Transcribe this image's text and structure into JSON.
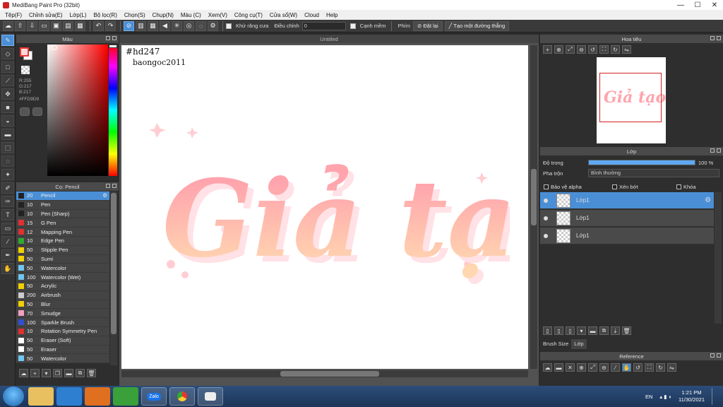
{
  "window": {
    "title": "MediBang Paint Pro (32bit)",
    "controls": [
      "—",
      "☐",
      "✕"
    ]
  },
  "menu": [
    "Tệp(F)",
    "Chỉnh sửa(E)",
    "Lớp(L)",
    "Bộ lọc(R)",
    "Chọn(S)",
    "Chụp(N)",
    "Màu (C)",
    "Xem(V)",
    "Công cụ(T)",
    "Cửa sổ(W)",
    "Cloud",
    "Help"
  ],
  "toolbar": {
    "antialias_label": "Khử răng cưa",
    "correction_label": "Điều chỉnh",
    "correction_value": "0",
    "edge_label": "Cạnh mềm",
    "key_label": "Phím",
    "reset_label": "Đặt lại",
    "straight_line_label": "Tạo một đường thẳng"
  },
  "color_panel": {
    "title": "Màu",
    "r": "R:255",
    "g": "G:217",
    "b": "B:217",
    "hex": "#FFD9D9",
    "primary": "#FFD9D9"
  },
  "brush_panel": {
    "title": "Cọ: Pencil",
    "brushes": [
      {
        "size": "20",
        "name": "Pencil",
        "color": "#222222"
      },
      {
        "size": "10",
        "name": "Pen",
        "color": "#222222"
      },
      {
        "size": "10",
        "name": "Pen (Sharp)",
        "color": "#222222"
      },
      {
        "size": "15",
        "name": "G Pen",
        "color": "#e03030"
      },
      {
        "size": "12",
        "name": "Mapping Pen",
        "color": "#e03030"
      },
      {
        "size": "10",
        "name": "Edge Pen",
        "color": "#2faa2f"
      },
      {
        "size": "50",
        "name": "Stipple Pen",
        "color": "#f0d000"
      },
      {
        "size": "50",
        "name": "Sumi",
        "color": "#f0d000"
      },
      {
        "size": "50",
        "name": "Watercolor",
        "color": "#6fc6f0"
      },
      {
        "size": "100",
        "name": "Watercolor (Wet)",
        "color": "#6fc6f0"
      },
      {
        "size": "50",
        "name": "Acrylic",
        "color": "#f0d000"
      },
      {
        "size": "200",
        "name": "Airbrush",
        "color": "#cccccc"
      },
      {
        "size": "50",
        "name": "Blur",
        "color": "#f0d000"
      },
      {
        "size": "70",
        "name": "Smudge",
        "color": "#f3a0c0"
      },
      {
        "size": "100",
        "name": "Sparkle Brush",
        "color": "#3050d0"
      },
      {
        "size": "10",
        "name": "Rotation Symmetry Pen",
        "color": "#e03030"
      },
      {
        "size": "50",
        "name": "Eraser (Soft)",
        "color": "#ffffff"
      },
      {
        "size": "50",
        "name": "Eraser",
        "color": "#ffffff"
      },
      {
        "size": "50",
        "name": "Watercolor",
        "color": "#6fc6f0"
      }
    ]
  },
  "canvas": {
    "tab": "Untitled",
    "hashtag": "#hd247",
    "author": "baongoc2011",
    "art_text": "Giả tạo",
    "art_top": "#ffa4ad",
    "art_bottom": "#ffd7b0",
    "art_shadow": "#ffe1e6"
  },
  "navigator": {
    "title": "Hoa tiêu",
    "frame_color": "#d22222"
  },
  "layer_panel": {
    "title": "Lớp",
    "opacity_label": "Độ trong",
    "opacity_value": "100 %",
    "blend_label": "Pha trộn",
    "blend_value": "Bình thường",
    "protect_alpha": "Bảo vệ alpha",
    "clipping": "Xén bớt",
    "lock": "Khóa",
    "layers": [
      "Lớp1",
      "Lớp1",
      "Lớp1"
    ],
    "tab_brush_size": "Brush Size",
    "tab_layer": "Lớp"
  },
  "reference_panel": {
    "title": "Reference"
  },
  "taskbar": {
    "apps": [
      "",
      "",
      "",
      "",
      "Zalo",
      "",
      ""
    ],
    "lang": "EN",
    "time": "1:21 PM",
    "date": "11/30/2021"
  }
}
